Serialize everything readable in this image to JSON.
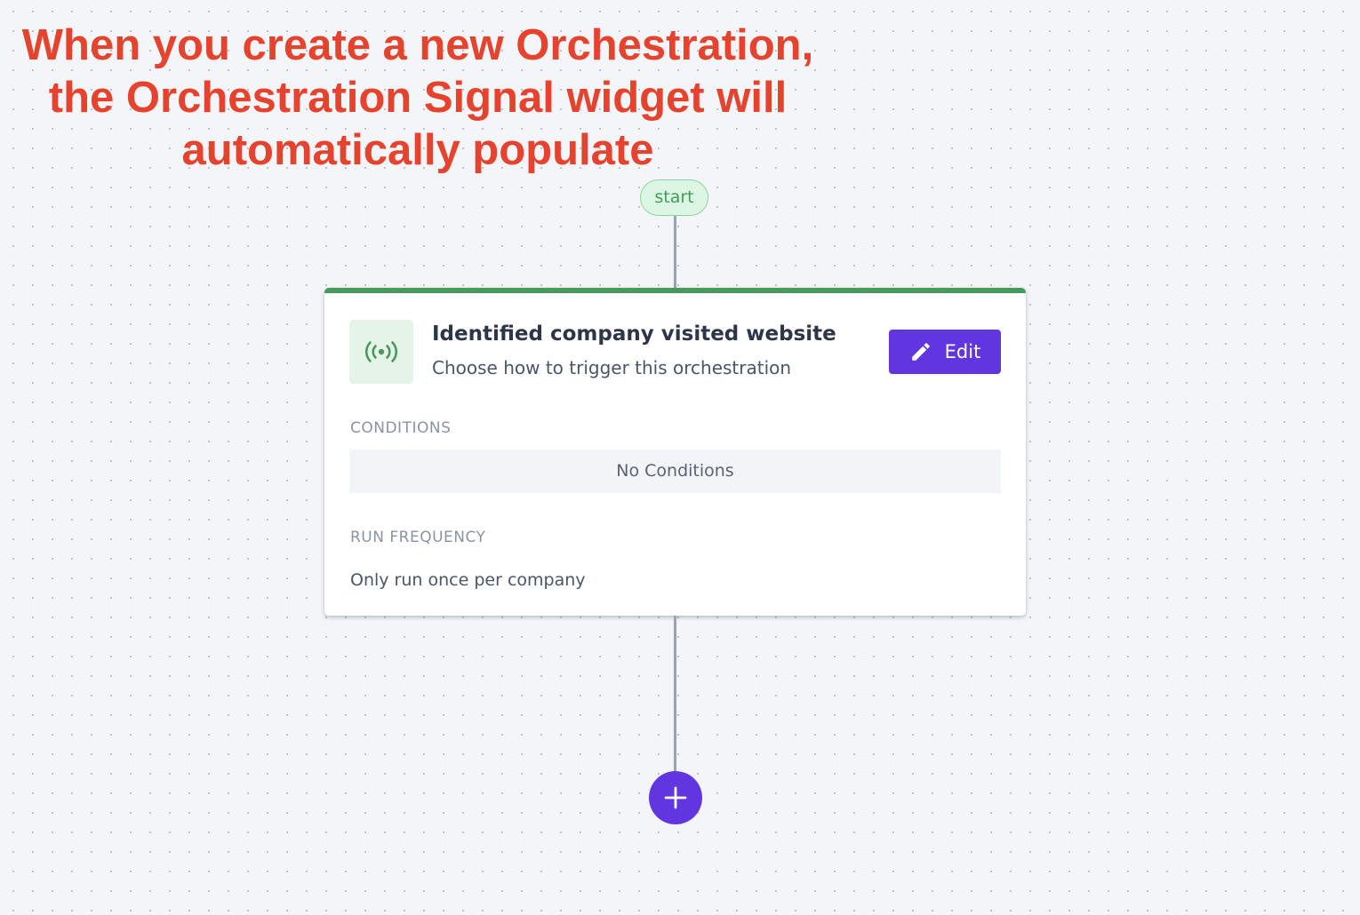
{
  "annotation": {
    "line1": "When you create a new Orchestration,",
    "line2": "the Orchestration Signal widget will",
    "line3": "automatically populate",
    "color": "#e5432e"
  },
  "flow": {
    "start_label": "start",
    "add_step_icon": "plus-icon"
  },
  "signal_card": {
    "icon": "broadcast-signal-icon",
    "title": "Identified company visited website",
    "subtitle": "Choose how to trigger this orchestration",
    "edit_label": "Edit",
    "edit_icon": "pencil-icon",
    "conditions_heading": "CONDITIONS",
    "conditions_value": "No Conditions",
    "frequency_heading": "RUN FREQUENCY",
    "frequency_value": "Only run once per company"
  },
  "colors": {
    "accent": "#6136e0",
    "success": "#479a5b",
    "start_pill_bg": "#dcf6e3",
    "canvas_bg": "#f4f5f8"
  }
}
